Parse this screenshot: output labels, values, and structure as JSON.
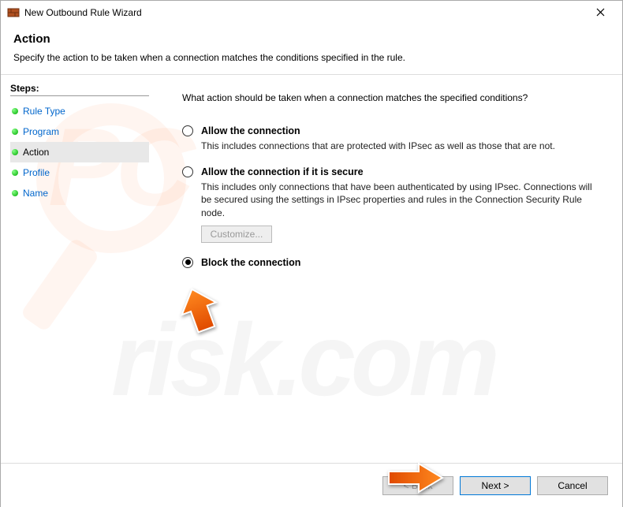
{
  "titlebar": {
    "title": "New Outbound Rule Wizard"
  },
  "header": {
    "heading": "Action",
    "subheading": "Specify the action to be taken when a connection matches the conditions specified in the rule."
  },
  "sidebar": {
    "label": "Steps:",
    "items": [
      {
        "label": "Rule Type"
      },
      {
        "label": "Program"
      },
      {
        "label": "Action"
      },
      {
        "label": "Profile"
      },
      {
        "label": "Name"
      }
    ]
  },
  "content": {
    "prompt": "What action should be taken when a connection matches the specified conditions?",
    "options": {
      "allow": {
        "title": "Allow the connection",
        "desc": "This includes connections that are protected with IPsec as well as those that are not."
      },
      "allow_secure": {
        "title": "Allow the connection if it is secure",
        "desc": "This includes only connections that have been authenticated by using IPsec. Connections will be secured using the settings in IPsec properties and rules in the Connection Security Rule node.",
        "customize": "Customize..."
      },
      "block": {
        "title": "Block the connection"
      }
    }
  },
  "footer": {
    "back": "< Back",
    "next": "Next >",
    "cancel": "Cancel"
  }
}
